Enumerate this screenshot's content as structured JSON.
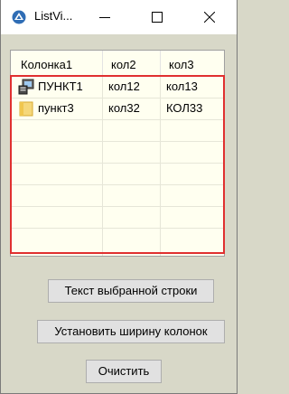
{
  "window": {
    "title": "ListVi...",
    "controls": {
      "minimize": "minimize",
      "maximize": "maximize",
      "close": "close"
    }
  },
  "listview": {
    "columns": [
      "Колонка1",
      "кол2",
      "кол3"
    ],
    "rows": [
      {
        "icon": "computer-icon",
        "cells": [
          "ПУНКТ1",
          "кол12",
          "кол13"
        ]
      },
      {
        "icon": "folder-icon",
        "cells": [
          "пункт3",
          "кол32",
          "КОЛ33"
        ]
      }
    ],
    "selection_color": "#e03030"
  },
  "buttons": {
    "get_selected": "Текст выбранной строки",
    "set_width": "Установить ширину колонок",
    "clear": "Очистить"
  }
}
